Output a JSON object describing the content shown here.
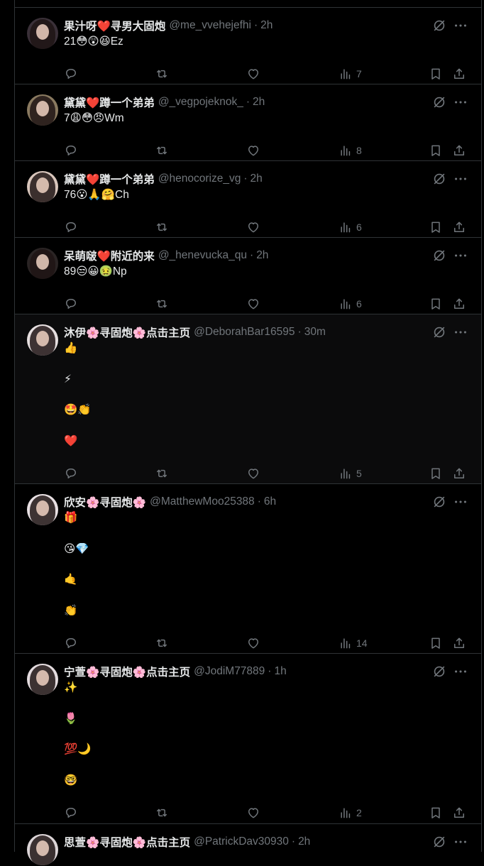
{
  "colors": {
    "background": "#000000",
    "text": "#e7e9ea",
    "secondary": "#71767b",
    "border": "#2f3336"
  },
  "posts": [
    {
      "name": "果汁呀❤️寻男大固炮",
      "handle": "@me_vvehejefhi",
      "time": "2h",
      "lines": [
        "21😳😲😆Ez"
      ],
      "views": "7",
      "avatar_bg": "#3a3038"
    },
    {
      "name": "黛黛❤️蹲一个弟弟",
      "handle": "@_vegpojeknok_",
      "time": "2h",
      "lines": [
        "7😩😳😠Wm"
      ],
      "views": "8",
      "avatar_bg": "#8a7a60"
    },
    {
      "name": "黛黛❤️蹲一个弟弟",
      "handle": "@henocorize_vg",
      "time": "2h",
      "lines": [
        "76😮🙏🤗Ch"
      ],
      "views": "6",
      "avatar_bg": "#d9c6bc"
    },
    {
      "name": "呆萌啵❤️附近的来",
      "handle": "@_henevucka_qu",
      "time": "2h",
      "lines": [
        "89😒😀🤢Np"
      ],
      "views": "6",
      "avatar_bg": "#2a2424"
    },
    {
      "name": "沐伊🌸寻固炮🌸点击主页",
      "handle": "@DeborahBar16595",
      "time": "30m",
      "lines": [
        "👍",
        "⚡",
        "🤩👏",
        "❤️"
      ],
      "views": "5",
      "avatar_bg": "#e6dfe0"
    },
    {
      "name": "欣安🌸寻固炮🌸",
      "handle": "@MatthewMoo25388",
      "time": "6h",
      "lines": [
        "🎁",
        "😘💎",
        "🤙",
        "👏"
      ],
      "views": "14",
      "avatar_bg": "#e9e1e4"
    },
    {
      "name": "宁萱🌸寻固炮🌸点击主页",
      "handle": "@JodiM77889",
      "time": "1h",
      "lines": [
        "✨",
        "🌷",
        "💯🌙",
        "🤓"
      ],
      "views": "2",
      "avatar_bg": "#e4dcdf"
    },
    {
      "name": "思萱🌸寻固炮🌸点击主页",
      "handle": "@PatrickDav30930",
      "time": "2h",
      "lines": [],
      "views": "",
      "avatar_bg": "#ddd6d8"
    }
  ]
}
